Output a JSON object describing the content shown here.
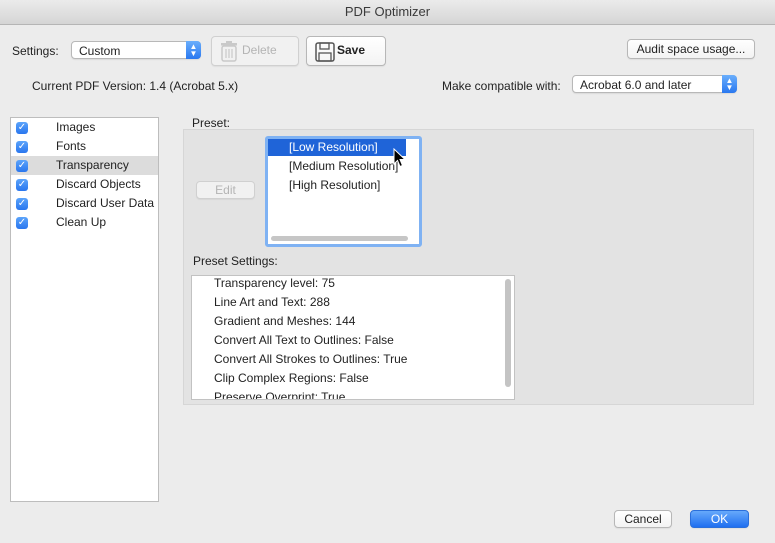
{
  "window": {
    "title": "PDF Optimizer"
  },
  "settings": {
    "label": "Settings:",
    "value": "Custom",
    "delete_label": "Delete",
    "save_label": "Save",
    "audit_label": "Audit space usage..."
  },
  "version": {
    "current_label": "Current PDF Version: 1.4 (Acrobat 5.x)",
    "compat_label": "Make compatible with:",
    "compat_value": "Acrobat 6.0 and later"
  },
  "categories": [
    {
      "label": "Images",
      "checked": true
    },
    {
      "label": "Fonts",
      "checked": true
    },
    {
      "label": "Transparency",
      "checked": true,
      "selected": true
    },
    {
      "label": "Discard Objects",
      "checked": true
    },
    {
      "label": "Discard User Data",
      "checked": true
    },
    {
      "label": "Clean Up",
      "checked": true
    }
  ],
  "preset": {
    "label": "Preset:",
    "edit_label": "Edit",
    "items": [
      "[Low Resolution]",
      "[Medium Resolution]",
      "[High Resolution]"
    ],
    "selected": "[Low Resolution]"
  },
  "preset_settings": {
    "label": "Preset Settings:",
    "rows": [
      "Transparency level: 75",
      "Line Art and Text: 288",
      "Gradient and Meshes: 144",
      "Convert All Text to Outlines: False",
      "Convert All Strokes to Outlines: True",
      "Clip Complex Regions: False",
      "Preserve Overprint: True"
    ]
  },
  "footer": {
    "cancel_label": "Cancel",
    "ok_label": "OK"
  },
  "colors": {
    "accent": "#1f64d8",
    "check": "#2a76ee",
    "selection_gray": "#dcdcdc"
  }
}
